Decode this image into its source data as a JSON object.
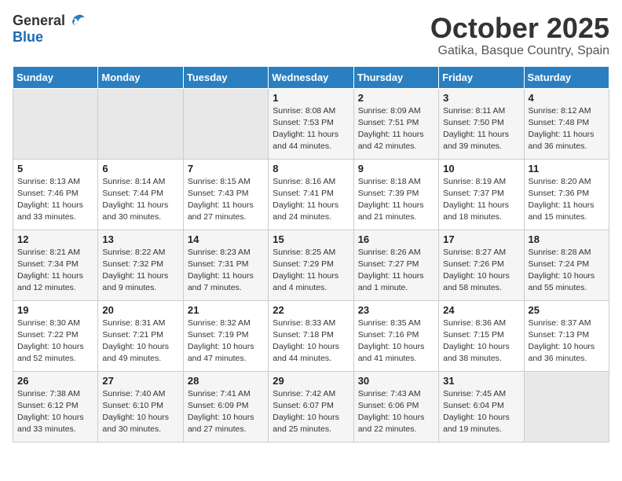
{
  "header": {
    "logo_general": "General",
    "logo_blue": "Blue",
    "month_title": "October 2025",
    "subtitle": "Gatika, Basque Country, Spain"
  },
  "days_of_week": [
    "Sunday",
    "Monday",
    "Tuesday",
    "Wednesday",
    "Thursday",
    "Friday",
    "Saturday"
  ],
  "weeks": [
    [
      {
        "day": "",
        "info": ""
      },
      {
        "day": "",
        "info": ""
      },
      {
        "day": "",
        "info": ""
      },
      {
        "day": "1",
        "info": "Sunrise: 8:08 AM\nSunset: 7:53 PM\nDaylight: 11 hours and 44 minutes."
      },
      {
        "day": "2",
        "info": "Sunrise: 8:09 AM\nSunset: 7:51 PM\nDaylight: 11 hours and 42 minutes."
      },
      {
        "day": "3",
        "info": "Sunrise: 8:11 AM\nSunset: 7:50 PM\nDaylight: 11 hours and 39 minutes."
      },
      {
        "day": "4",
        "info": "Sunrise: 8:12 AM\nSunset: 7:48 PM\nDaylight: 11 hours and 36 minutes."
      }
    ],
    [
      {
        "day": "5",
        "info": "Sunrise: 8:13 AM\nSunset: 7:46 PM\nDaylight: 11 hours and 33 minutes."
      },
      {
        "day": "6",
        "info": "Sunrise: 8:14 AM\nSunset: 7:44 PM\nDaylight: 11 hours and 30 minutes."
      },
      {
        "day": "7",
        "info": "Sunrise: 8:15 AM\nSunset: 7:43 PM\nDaylight: 11 hours and 27 minutes."
      },
      {
        "day": "8",
        "info": "Sunrise: 8:16 AM\nSunset: 7:41 PM\nDaylight: 11 hours and 24 minutes."
      },
      {
        "day": "9",
        "info": "Sunrise: 8:18 AM\nSunset: 7:39 PM\nDaylight: 11 hours and 21 minutes."
      },
      {
        "day": "10",
        "info": "Sunrise: 8:19 AM\nSunset: 7:37 PM\nDaylight: 11 hours and 18 minutes."
      },
      {
        "day": "11",
        "info": "Sunrise: 8:20 AM\nSunset: 7:36 PM\nDaylight: 11 hours and 15 minutes."
      }
    ],
    [
      {
        "day": "12",
        "info": "Sunrise: 8:21 AM\nSunset: 7:34 PM\nDaylight: 11 hours and 12 minutes."
      },
      {
        "day": "13",
        "info": "Sunrise: 8:22 AM\nSunset: 7:32 PM\nDaylight: 11 hours and 9 minutes."
      },
      {
        "day": "14",
        "info": "Sunrise: 8:23 AM\nSunset: 7:31 PM\nDaylight: 11 hours and 7 minutes."
      },
      {
        "day": "15",
        "info": "Sunrise: 8:25 AM\nSunset: 7:29 PM\nDaylight: 11 hours and 4 minutes."
      },
      {
        "day": "16",
        "info": "Sunrise: 8:26 AM\nSunset: 7:27 PM\nDaylight: 11 hours and 1 minute."
      },
      {
        "day": "17",
        "info": "Sunrise: 8:27 AM\nSunset: 7:26 PM\nDaylight: 10 hours and 58 minutes."
      },
      {
        "day": "18",
        "info": "Sunrise: 8:28 AM\nSunset: 7:24 PM\nDaylight: 10 hours and 55 minutes."
      }
    ],
    [
      {
        "day": "19",
        "info": "Sunrise: 8:30 AM\nSunset: 7:22 PM\nDaylight: 10 hours and 52 minutes."
      },
      {
        "day": "20",
        "info": "Sunrise: 8:31 AM\nSunset: 7:21 PM\nDaylight: 10 hours and 49 minutes."
      },
      {
        "day": "21",
        "info": "Sunrise: 8:32 AM\nSunset: 7:19 PM\nDaylight: 10 hours and 47 minutes."
      },
      {
        "day": "22",
        "info": "Sunrise: 8:33 AM\nSunset: 7:18 PM\nDaylight: 10 hours and 44 minutes."
      },
      {
        "day": "23",
        "info": "Sunrise: 8:35 AM\nSunset: 7:16 PM\nDaylight: 10 hours and 41 minutes."
      },
      {
        "day": "24",
        "info": "Sunrise: 8:36 AM\nSunset: 7:15 PM\nDaylight: 10 hours and 38 minutes."
      },
      {
        "day": "25",
        "info": "Sunrise: 8:37 AM\nSunset: 7:13 PM\nDaylight: 10 hours and 36 minutes."
      }
    ],
    [
      {
        "day": "26",
        "info": "Sunrise: 7:38 AM\nSunset: 6:12 PM\nDaylight: 10 hours and 33 minutes."
      },
      {
        "day": "27",
        "info": "Sunrise: 7:40 AM\nSunset: 6:10 PM\nDaylight: 10 hours and 30 minutes."
      },
      {
        "day": "28",
        "info": "Sunrise: 7:41 AM\nSunset: 6:09 PM\nDaylight: 10 hours and 27 minutes."
      },
      {
        "day": "29",
        "info": "Sunrise: 7:42 AM\nSunset: 6:07 PM\nDaylight: 10 hours and 25 minutes."
      },
      {
        "day": "30",
        "info": "Sunrise: 7:43 AM\nSunset: 6:06 PM\nDaylight: 10 hours and 22 minutes."
      },
      {
        "day": "31",
        "info": "Sunrise: 7:45 AM\nSunset: 6:04 PM\nDaylight: 10 hours and 19 minutes."
      },
      {
        "day": "",
        "info": ""
      }
    ]
  ]
}
